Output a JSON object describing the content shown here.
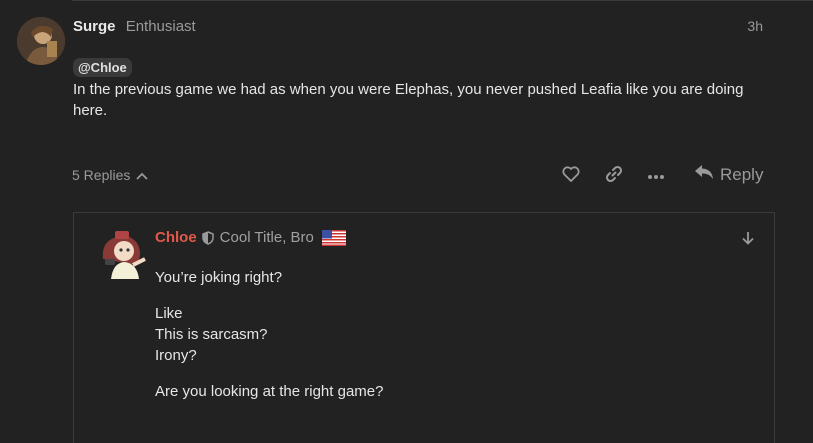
{
  "post": {
    "username": "Surge",
    "user_title": "Enthusiast",
    "date": "3h",
    "mention": "@Chloe",
    "body": "In the previous game we had as when you were Elephas, you never pushed Leafia like you are doing here.",
    "replies_label": "5 Replies",
    "reply_button": "Reply",
    "icons": [
      "heart-icon",
      "link-icon",
      "more-icon",
      "reply-arrow-icon",
      "chevron-up-icon"
    ]
  },
  "reply": {
    "username": "Chloe",
    "user_title": "Cool Title, Bro",
    "lines": [
      "You’re joking right?",
      "Like",
      "This is sarcasm?",
      "Irony?",
      "Are you looking at the right game?"
    ],
    "name_color": "#e05a4a",
    "icons": [
      "shield-icon",
      "us-flag-icon",
      "arrow-down-icon"
    ]
  }
}
